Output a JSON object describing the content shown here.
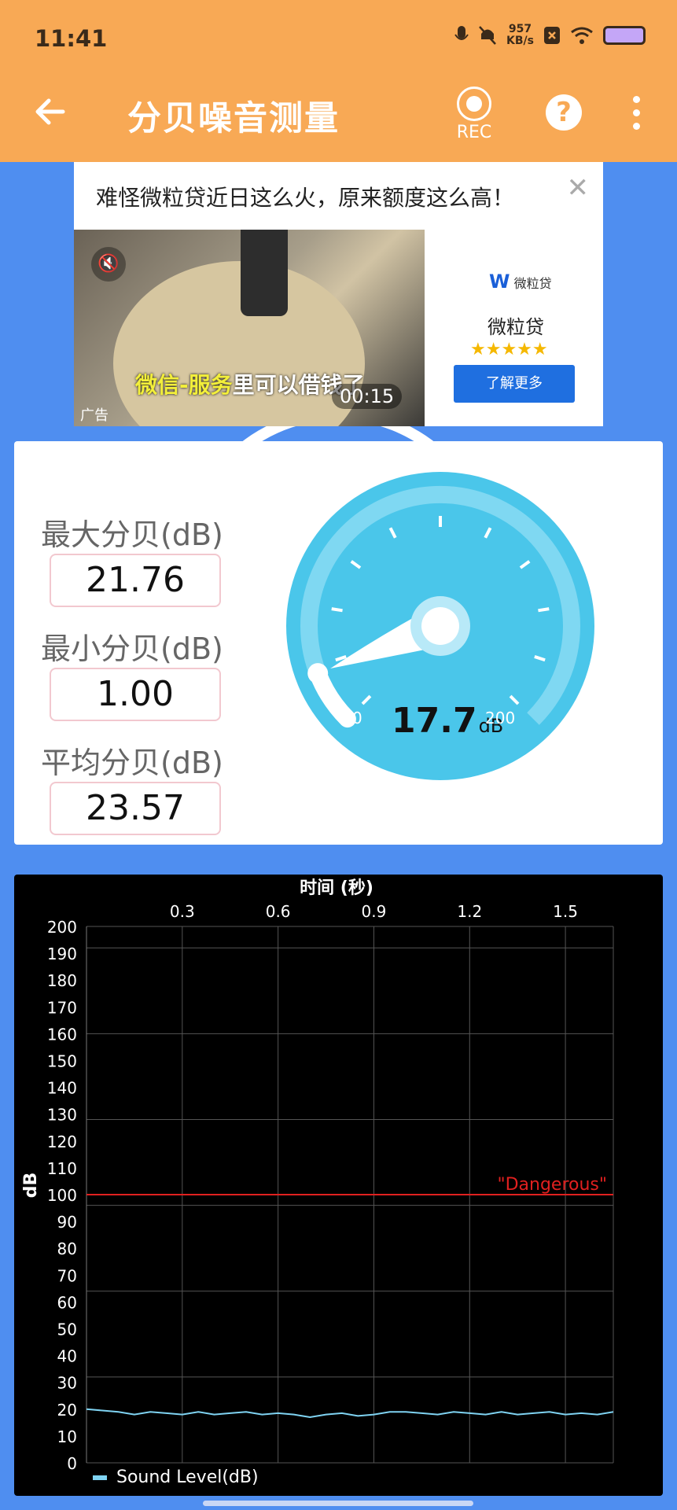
{
  "status_bar": {
    "time": "11:41",
    "net_speed_value": "957",
    "net_speed_unit": "KB/s"
  },
  "app_bar": {
    "title": "分贝噪音测量",
    "rec_label": "REC"
  },
  "ad": {
    "headline": "难怪微粒贷近日这么火，原来额度这么高！",
    "video_caption_highlight": "微信-服务",
    "video_caption_rest": "里可以借钱了",
    "timer": "00:15",
    "tag": "广告",
    "brand_logo": "微粒贷",
    "brand_name": "微粒贷",
    "rating_stars": 5,
    "cta": "了解更多"
  },
  "meter": {
    "max_label": "最大分贝(dB)",
    "max_value": "21.76",
    "min_label": "最小分贝(dB)",
    "min_value": "1.00",
    "avg_label": "平均分贝(dB)",
    "avg_value": "23.57",
    "gauge_value": "17.7",
    "gauge_unit": "dB",
    "gauge_min": "0",
    "gauge_max": "200",
    "gauge_level": 17.7
  },
  "colors": {
    "topbar": "#f8a955",
    "background": "#4f8ef0",
    "gauge": "#4ac6ea",
    "danger": "#e0201f",
    "series": "#7fd3f2"
  },
  "chart_data": {
    "type": "line",
    "title": "",
    "xlabel": "时间 (秒)",
    "ylabel": "dB",
    "x_ticks": [
      "0.3",
      "0.6",
      "0.9",
      "1.2",
      "1.5"
    ],
    "y_ticks": [
      "0",
      "10",
      "20",
      "30",
      "40",
      "50",
      "60",
      "70",
      "80",
      "90",
      "100",
      "110",
      "120",
      "130",
      "140",
      "150",
      "160",
      "170",
      "180",
      "190",
      "200"
    ],
    "xlim": [
      0,
      1.65
    ],
    "ylim": [
      0,
      200
    ],
    "threshold": {
      "value": 100,
      "label": "\"Dangerous\""
    },
    "legend": "bottom-left",
    "series": [
      {
        "name": "Sound Level(dB)",
        "x": [
          0,
          0.05,
          0.1,
          0.15,
          0.2,
          0.25,
          0.3,
          0.35,
          0.4,
          0.45,
          0.5,
          0.55,
          0.6,
          0.65,
          0.7,
          0.75,
          0.8,
          0.85,
          0.9,
          0.95,
          1.0,
          1.05,
          1.1,
          1.15,
          1.2,
          1.25,
          1.3,
          1.35,
          1.4,
          1.45,
          1.5,
          1.55,
          1.6,
          1.65
        ],
        "values": [
          20,
          19.5,
          19,
          18,
          19,
          18.5,
          18,
          19,
          18,
          18.5,
          19,
          18,
          18.5,
          18,
          17,
          18,
          18.5,
          17.5,
          18,
          19,
          19,
          18.5,
          18,
          19,
          18.5,
          18,
          19,
          18,
          18.5,
          19,
          18,
          18.5,
          18,
          19
        ]
      }
    ]
  }
}
